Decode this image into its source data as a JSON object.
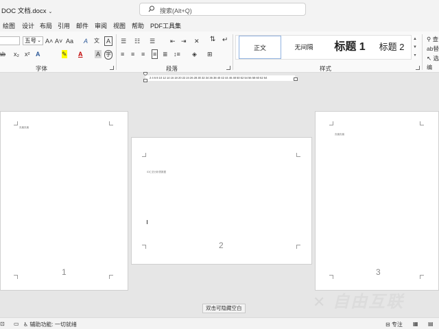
{
  "titlebar": {
    "doc_title": "DOC 文档.docx",
    "search_placeholder": "搜索(Alt+Q)"
  },
  "menu": {
    "tabs": [
      "绘图",
      "设计",
      "布局",
      "引用",
      "邮件",
      "审阅",
      "视图",
      "帮助",
      "PDF工具集"
    ]
  },
  "ribbon": {
    "font_size": "五号",
    "groups": {
      "font": "字体",
      "paragraph": "段落",
      "styles": "样式"
    },
    "styles": [
      "正文",
      "无间隔",
      "标题 1",
      "标题 2"
    ],
    "font_buttons": {
      "grow": "A˄",
      "shrink": "A˅",
      "case": "Aa",
      "clear": "A",
      "char_border": "A",
      "strike": "ab",
      "subscript": "x₂",
      "superscript": "x²",
      "text_effects": "A",
      "highlight": "✎",
      "font_color": "A",
      "char_shading": "A",
      "enclosed": "字"
    },
    "right_edge": [
      "查",
      "替",
      "选",
      "编"
    ]
  },
  "ruler": {
    "ticks": "2 4 6 8 10 12 14 16 18 20 22 24 26 28 30 32 34 36 38 40 42 44 46 48 50 52 54 56 58 60 62 64"
  },
  "pages": [
    {
      "number": "1",
      "header_text": "页眉页眉"
    },
    {
      "number": "2",
      "header_text": "ID汇总分析表数据"
    },
    {
      "number": "3",
      "header_text": "页眉页眉"
    }
  ],
  "tooltip": "双击可隐藏空白",
  "statusbar": {
    "accessibility": "辅助功能: 一切就绪",
    "focus": "专注"
  },
  "watermark": "自由互联"
}
